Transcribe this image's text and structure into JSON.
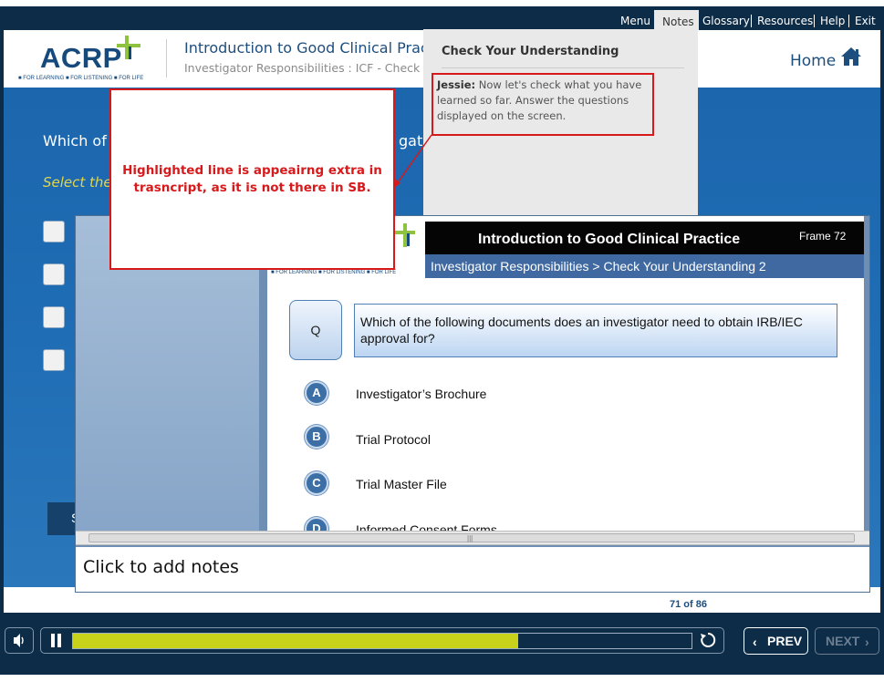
{
  "topnav": {
    "items": [
      "Menu",
      "Notes",
      "Glossary",
      "Resources",
      "Help",
      "Exit"
    ]
  },
  "header": {
    "logo": "ACRP",
    "tagline": "■ FOR LEARNING ■ FOR LISTENING ■ FOR LIFE",
    "course_title": "Introduction to Good Clinical Practice",
    "course_subtitle": "Investigator Responsibilities : ICF - Check Your Understanding",
    "home_label": "Home"
  },
  "stage": {
    "question": "Which of the following documents does an investigator need to obtain IRB/IEC approval for?",
    "question_visible_start": "Which of",
    "question_visible_end": "gato",
    "select_hint": "Select the",
    "submit_label": "S"
  },
  "notes_panel": {
    "heading": "Check Your Understanding",
    "speaker": "Jessie:",
    "text": "Now let's check what you have learned so far. Answer the questions displayed on the screen."
  },
  "review_comment": "Highlighted line is appeairng extra in trasncript, as it is not there in SB.",
  "preview": {
    "slide_title": "Introduction to Good Clinical Practice",
    "frame_label": "Frame 72",
    "slide_subtitle": "Investigator Responsibilities  > Check Your Understanding 2",
    "q_label": "Q",
    "question": "Which of the following documents does an investigator need to obtain IRB/IEC approval for?",
    "options": [
      {
        "letter": "A",
        "text": "Investigator’s Brochure"
      },
      {
        "letter": "B",
        "text": "Trial Protocol"
      },
      {
        "letter": "C",
        "text": "Trial Master File"
      },
      {
        "letter": "D",
        "text": "Informed Consent Forms"
      }
    ],
    "notes_placeholder": "Click to add notes"
  },
  "player": {
    "page_count": "71 of 86",
    "progress": 0.72,
    "prev_label": "PREV",
    "next_label": "NEXT"
  },
  "colors": {
    "navy": "#0d2c48",
    "stage_blue": "#1f6db5",
    "progress_yellow": "#c9d21a",
    "review_red": "#d8191b"
  }
}
